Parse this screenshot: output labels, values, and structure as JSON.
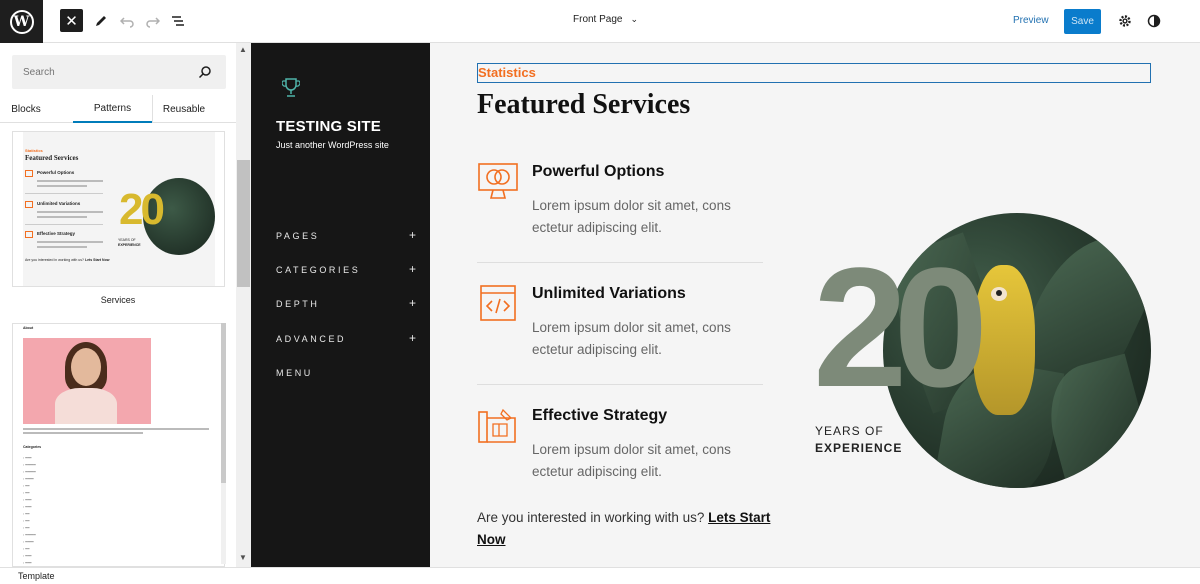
{
  "topbar": {
    "document_title": "Front Page",
    "preview_label": "Preview",
    "save_label": "Save"
  },
  "sidebar": {
    "search_placeholder": "Search",
    "tabs": [
      {
        "label": "Blocks",
        "active": false
      },
      {
        "label": "Patterns",
        "active": true
      },
      {
        "label": "Reusable",
        "active": false
      }
    ],
    "patterns": [
      {
        "label": "Services",
        "preview": {
          "eyebrow": "Statistics",
          "title": "Featured Services",
          "items": [
            "Powerful Options",
            "Unlimited Variations",
            "Effective Strategy"
          ],
          "number": "20",
          "years_line1": "YEARS OF",
          "years_line2": "EXPERIENCE",
          "cta": "Are you interested in working with us?",
          "cta_link": "Lets Start Now"
        }
      },
      {
        "label": "",
        "preview": {
          "heading": "About",
          "categories_heading": "Categories"
        }
      }
    ]
  },
  "site": {
    "title": "TESTING SITE",
    "tagline": "Just another WordPress site",
    "nav": [
      {
        "label": "PAGES",
        "has_children": true
      },
      {
        "label": "CATEGORIES",
        "has_children": true
      },
      {
        "label": "DEPTH",
        "has_children": true
      },
      {
        "label": "ADVANCED",
        "has_children": true
      },
      {
        "label": "MENU",
        "has_children": false
      }
    ]
  },
  "content": {
    "eyebrow": "Statistics",
    "title": "Featured Services",
    "services": [
      {
        "title": "Powerful Options",
        "description": "Lorem ipsum dolor sit amet, cons ectetur adipiscing elit.",
        "icon": "monitor-icon"
      },
      {
        "title": "Unlimited Variations",
        "description": "Lorem ipsum dolor sit amet, cons ectetur adipiscing elit.",
        "icon": "code-window-icon"
      },
      {
        "title": "Effective Strategy",
        "description": "Lorem ipsum dolor sit amet, cons ectetur adipiscing elit.",
        "icon": "blueprint-icon"
      }
    ],
    "cta_text": "Are you interested in working with us?",
    "cta_link": "Lets Start Now",
    "years_number": "20",
    "years_line1": "YEARS OF",
    "years_line2": "EXPERIENCE"
  },
  "footer": {
    "breadcrumb": "Template"
  },
  "colors": {
    "accent": "#f26f21",
    "wp_blue": "#2271b1",
    "save_blue": "#0a7ccc",
    "nav_bg": "#161616"
  }
}
